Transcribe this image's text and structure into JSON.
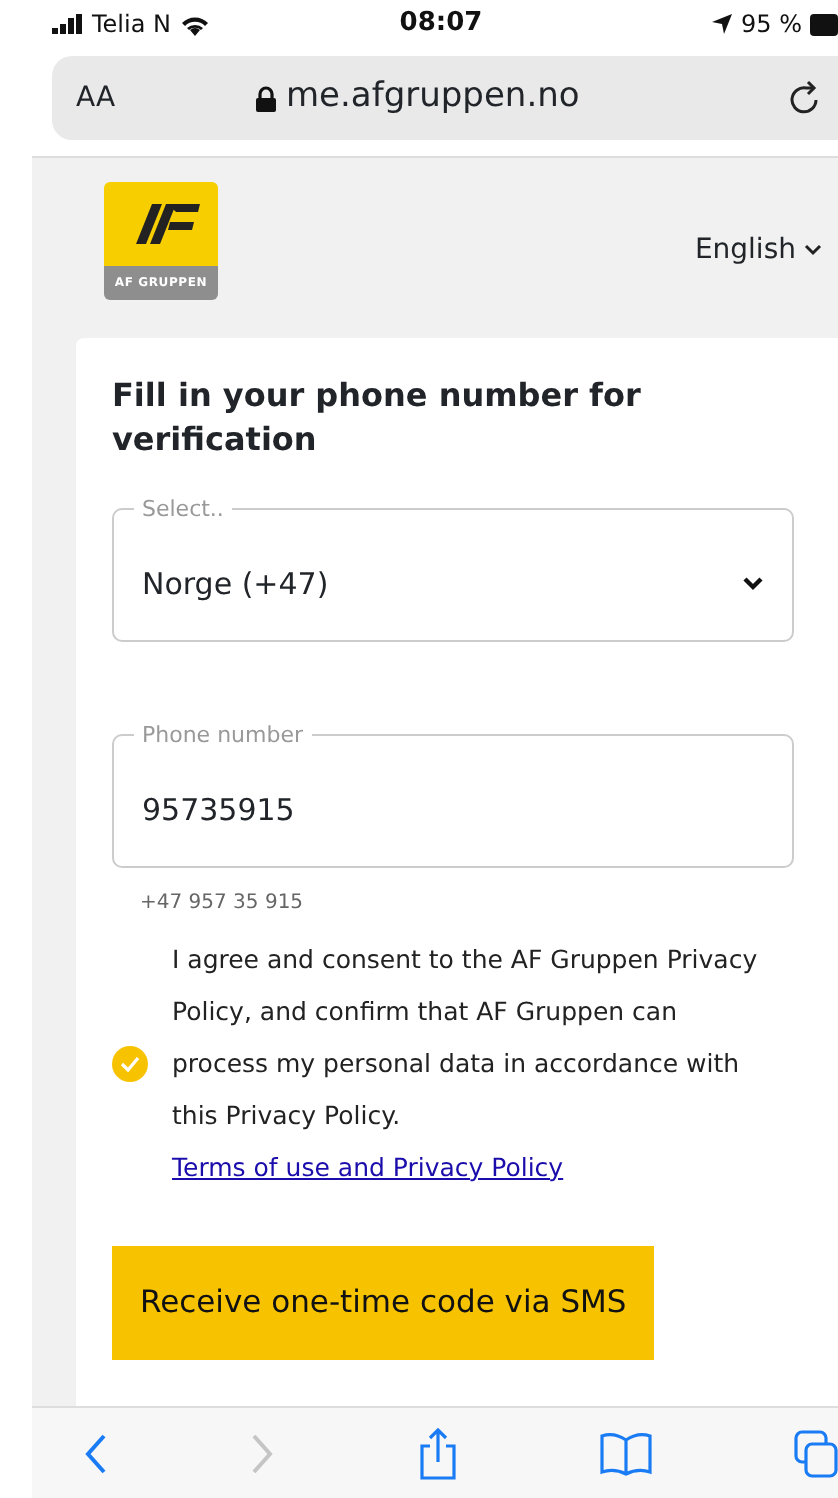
{
  "status_bar": {
    "carrier": "Telia N",
    "time": "08:07",
    "battery": "95 %"
  },
  "browser": {
    "text_size": "AA",
    "url": "me.afgruppen.no"
  },
  "header": {
    "logo_caption": "AF GRUPPEN",
    "language": "English"
  },
  "form": {
    "title": "Fill in your phone number for verification",
    "country": {
      "label": "Select..",
      "value": "Norge (+47)"
    },
    "phone": {
      "label": "Phone number",
      "value": "95735915",
      "hint": "+47 957 35 915"
    },
    "consent": {
      "checked": true,
      "text": "I agree and consent to the AF Gruppen Privacy Policy, and confirm that AF Gruppen can process my personal data in accordance with this Privacy Policy.",
      "link": "Terms of use and Privacy Policy"
    },
    "submit": "Receive one-time code via SMS"
  }
}
